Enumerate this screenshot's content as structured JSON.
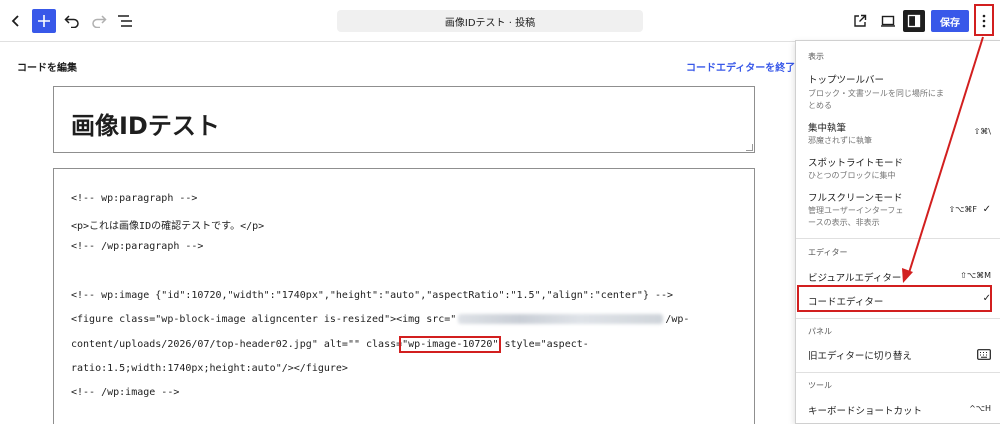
{
  "topbar": {
    "document_title": "画像IDテスト · 投稿",
    "save_label": "保存"
  },
  "code_editor": {
    "heading": "コードを編集",
    "exit_link": "コードエディターを終了",
    "post_title": "画像IDテスト",
    "lines": {
      "l1": "<!-- wp:paragraph -->",
      "l2": "<p>これは画像IDの確認テストです。</p>",
      "l3": "<!-- /wp:paragraph -->",
      "l4": "<!-- wp:image {\"id\":10720,\"width\":\"1740px\",\"height\":\"auto\",\"aspectRatio\":\"1.5\",\"align\":\"center\"} -->",
      "l5_a": "<figure class=\"wp-block-image aligncenter is-resized\"><img src=\"",
      "l5_b": "/wp-",
      "l6_a": "content/uploads/2026/07/top-header02.jpg\" alt=\"\" class=",
      "l6_class": "\"wp-image-10720\"",
      "l6_b": " style=\"aspect-",
      "l7": "ratio:1.5;width:1740px;height:auto\"/></figure>",
      "l8": "<!-- /wp:image -->"
    }
  },
  "menu": {
    "view": {
      "heading": "表示",
      "top_toolbar": {
        "label": "トップツールバー",
        "desc1": "ブロック・文書ツールを同じ場所にま",
        "desc2": "とめる"
      },
      "focus_mode": {
        "label": "集中執筆",
        "desc": "邪魔されずに執筆",
        "shortcut": "⇧⌘\\"
      },
      "spotlight_mode": {
        "label": "スポットライトモード",
        "desc": "ひとつのブロックに集中"
      },
      "fullscreen_mode": {
        "label": "フルスクリーンモード",
        "desc1": "管理ユーザーインターフェ",
        "desc2": "ースの表示、非表示",
        "shortcut": "⇧⌥⌘F",
        "check": "✓"
      }
    },
    "editor": {
      "heading": "エディター",
      "visual": {
        "label": "ビジュアルエディター",
        "shortcut": "⇧⌥⌘M"
      },
      "code": {
        "label": "コードエディター",
        "check": "✓"
      }
    },
    "panel": {
      "heading": "パネル",
      "switch_classic": {
        "label": "旧エディターに切り替え"
      }
    },
    "tools": {
      "heading": "ツール",
      "keyboard_shortcuts": {
        "label": "キーボードショートカット",
        "shortcut": "^⌥H"
      }
    }
  },
  "colors": {
    "accent": "#3858e9",
    "annotation": "#d21f1f"
  }
}
